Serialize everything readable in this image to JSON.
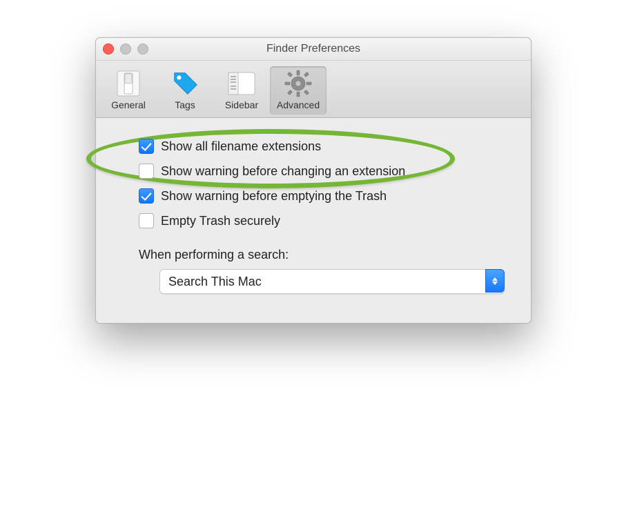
{
  "window": {
    "title": "Finder Preferences"
  },
  "toolbar": {
    "items": [
      {
        "key": "general",
        "label": "General"
      },
      {
        "key": "tags",
        "label": "Tags"
      },
      {
        "key": "sidebar",
        "label": "Sidebar"
      },
      {
        "key": "advanced",
        "label": "Advanced"
      }
    ],
    "selected": "advanced"
  },
  "options": [
    {
      "key": "show-ext",
      "label": "Show all filename extensions",
      "checked": true
    },
    {
      "key": "warn-ext",
      "label": "Show warning before changing an extension",
      "checked": false
    },
    {
      "key": "warn-trash",
      "label": "Show warning before emptying the Trash",
      "checked": true
    },
    {
      "key": "secure-trash",
      "label": "Empty Trash securely",
      "checked": false
    }
  ],
  "search": {
    "label": "When performing a search:",
    "selected": "Search This Mac"
  },
  "annotation": {
    "highlighted_option": "show-ext",
    "color": "#76b636"
  }
}
